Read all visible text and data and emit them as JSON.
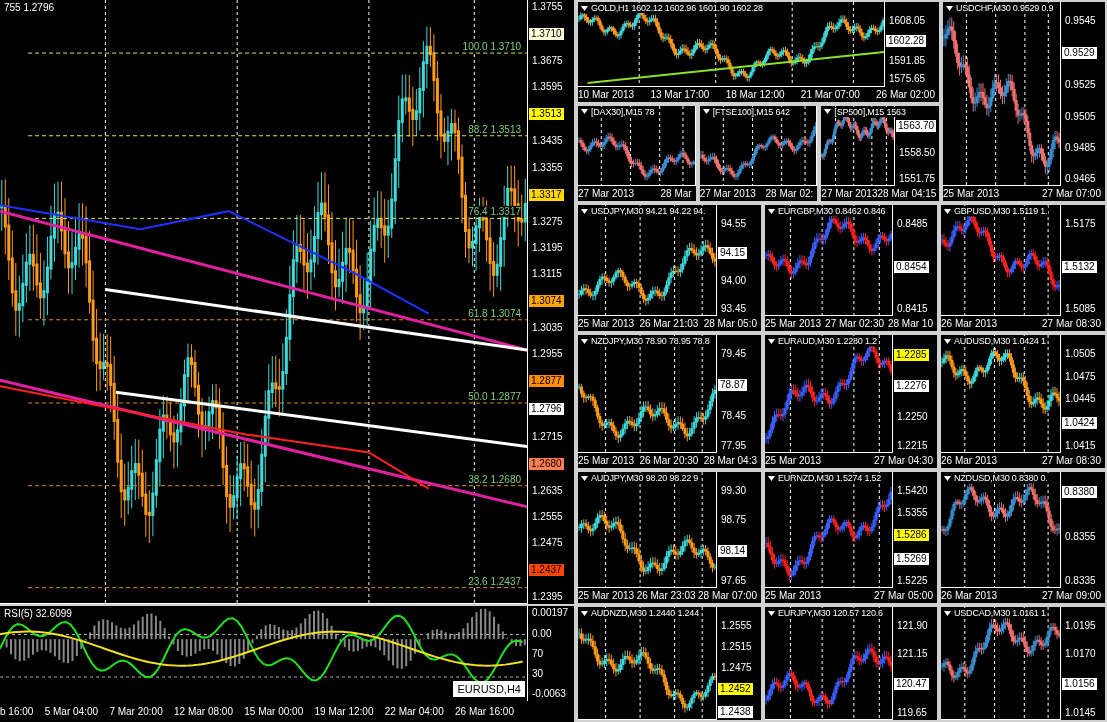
{
  "main_chart": {
    "title": "755 1.2796",
    "fib_levels": [
      {
        "label": "100.0 1.3710"
      },
      {
        "label": "88.2 1.3513"
      },
      {
        "label": "76.4 1.3317"
      },
      {
        "label": "61.8 1.3074"
      },
      {
        "label": "50.0 1.2877"
      },
      {
        "label": "38.2 1.2680"
      },
      {
        "label": "23.6 1.2437"
      }
    ],
    "price_axis": [
      {
        "kind": "tick",
        "text": "1.3755"
      },
      {
        "kind": "tag",
        "text": "1.3710",
        "color": "#fffbd8"
      },
      {
        "kind": "tick",
        "text": "1.3675"
      },
      {
        "kind": "tick",
        "text": "1.3595"
      },
      {
        "kind": "tag",
        "text": "1.3513",
        "color": "#ffff00"
      },
      {
        "kind": "tick",
        "text": "1.3435"
      },
      {
        "kind": "tick",
        "text": "1.3355"
      },
      {
        "kind": "tag",
        "text": "1.3317",
        "color": "#ffd700"
      },
      {
        "kind": "tick",
        "text": "1.3275"
      },
      {
        "kind": "tick",
        "text": "1.3195"
      },
      {
        "kind": "tick",
        "text": "1.3115"
      },
      {
        "kind": "tag",
        "text": "1.3074",
        "color": "#ffa500"
      },
      {
        "kind": "tick",
        "text": "1.3035"
      },
      {
        "kind": "tick",
        "text": "1.2955"
      },
      {
        "kind": "tag",
        "text": "1.2877",
        "color": "#ff8c00"
      },
      {
        "kind": "tag",
        "text": "1.2796",
        "color": "#ffffff"
      },
      {
        "kind": "tick",
        "text": "1.2715"
      },
      {
        "kind": "tag",
        "text": "1.2680",
        "color": "#ff7f50"
      },
      {
        "kind": "tick",
        "text": "1.2635"
      },
      {
        "kind": "tick",
        "text": "1.2555"
      },
      {
        "kind": "tick",
        "text": "1.2475"
      },
      {
        "kind": "tag",
        "text": "1.2437",
        "color": "#ff4500"
      },
      {
        "kind": "tick",
        "text": "1.2395"
      }
    ],
    "indicator": {
      "title": "RSI(5) 32.6099",
      "axis": [
        "0.00197",
        "0.00",
        "70",
        "30",
        "-0.0063"
      ],
      "symbol": "EURUSD,H4"
    },
    "time_axis": [
      "b 16:00",
      "5 Mar 04:00",
      "7 Mar 20:00",
      "12 Mar 08:00",
      "15 Mar 00:00",
      "19 Mar 12:00",
      "22 Mar 04:00",
      "26 Mar 16:00"
    ]
  },
  "mini_charts": [
    {
      "title": "GOLD,H1 1602.12 1602.96 1601.90 1602.28",
      "price_axis": [
        {
          "kind": "tick",
          "text": "1608.05"
        },
        {
          "kind": "tag",
          "text": "1602.28",
          "color": "#ffffff"
        },
        {
          "kind": "tick",
          "text": "1591.85"
        },
        {
          "kind": "tick",
          "text": "1575.65"
        }
      ],
      "time_axis": [
        "10 Mar 2013",
        "13 Mar 17:00",
        "18 Mar 12:00",
        "21 Mar 07:00",
        "26 Mar 02:00"
      ]
    },
    {
      "title": "[DAX30],M15 78",
      "time_axis": [
        "27 Mar 2013",
        "28 Mar"
      ]
    },
    {
      "title": "[FTSE100],M15 642",
      "time_axis": [
        "27 Mar 2013",
        "28 Mar 02:"
      ]
    },
    {
      "title": "[SP500],M15 1563",
      "price_axis": [
        {
          "kind": "tag",
          "text": "1563.70",
          "color": "#ffffff"
        },
        {
          "kind": "tick",
          "text": "1558.50"
        },
        {
          "kind": "tick",
          "text": "1551.75"
        }
      ],
      "time_axis": [
        "27 Mar 2013",
        "28 Mar 04:15"
      ]
    },
    {
      "title": "USDCHF,M30 0.9529 0.9",
      "price_axis": [
        {
          "kind": "tick",
          "text": "0.9545"
        },
        {
          "kind": "tag",
          "text": "0.9529",
          "color": "#ffffff"
        },
        {
          "kind": "tick",
          "text": "0.9525"
        },
        {
          "kind": "tick",
          "text": "0.9505"
        },
        {
          "kind": "tick",
          "text": "0.9485"
        },
        {
          "kind": "tick",
          "text": "0.9465"
        }
      ],
      "time_axis": [
        "25 Mar 2013",
        "27 Mar 07:00"
      ]
    },
    {
      "title": "USDJPY,M30 94.21 94.22 94.",
      "price_axis": [
        {
          "kind": "tick",
          "text": "94.55"
        },
        {
          "kind": "tag",
          "text": "94.15",
          "color": "#ffffff"
        },
        {
          "kind": "tick",
          "text": "94.00"
        },
        {
          "kind": "tick",
          "text": "93.45"
        }
      ],
      "time_axis": [
        "25 Mar 2013",
        "26 Mar 21:03",
        "28 Mar 05:0"
      ]
    },
    {
      "title": "EURGBP,M30 0.8462 0.846",
      "price_axis": [
        {
          "kind": "tick",
          "text": "0.8485"
        },
        {
          "kind": "tag",
          "text": "0.8454",
          "color": "#ffffff"
        },
        {
          "kind": "tick",
          "text": "0.8415"
        }
      ],
      "time_axis": [
        "25 Mar 2013",
        "27 Mar 02:30",
        "28 Mar 10"
      ]
    },
    {
      "title": "GBPUSD,M30 1.5119 1.",
      "price_axis": [
        {
          "kind": "tick",
          "text": "1.5175"
        },
        {
          "kind": "tag",
          "text": "1.5132",
          "color": "#ffffff"
        },
        {
          "kind": "tick",
          "text": "1.5085"
        }
      ],
      "time_axis": [
        "26 Mar 2013",
        "27 Mar 08:30"
      ]
    },
    {
      "title": "NZDJPY,M30 78.90 78.95 78.8",
      "price_axis": [
        {
          "kind": "tick",
          "text": "79.45"
        },
        {
          "kind": "tag",
          "text": "78.87",
          "color": "#ffffff"
        },
        {
          "kind": "tick",
          "text": "78.45"
        },
        {
          "kind": "tick",
          "text": "77.95"
        }
      ],
      "time_axis": [
        "25 Mar 2013",
        "26 Mar 20:30",
        "28 Mar 04:3"
      ]
    },
    {
      "title": "EURAUD,M30 1.2280 1.2",
      "price_axis": [
        {
          "kind": "tag",
          "text": "1.2285",
          "color": "#ffff00"
        },
        {
          "kind": "tag",
          "text": "1.2276",
          "color": "#ffffff"
        },
        {
          "kind": "tick",
          "text": "1.2250"
        },
        {
          "kind": "tick",
          "text": "1.2215"
        }
      ],
      "time_axis": [
        "25 Mar 2013",
        "27 Mar 04:30"
      ]
    },
    {
      "title": "AUDUSD,M30 1.0424 1",
      "price_axis": [
        {
          "kind": "tick",
          "text": "1.0505"
        },
        {
          "kind": "tick",
          "text": "1.0475"
        },
        {
          "kind": "tick",
          "text": "1.0445"
        },
        {
          "kind": "tag",
          "text": "1.0424",
          "color": "#ffffff"
        },
        {
          "kind": "tick",
          "text": "1.0415"
        }
      ],
      "time_axis": [
        "26 Mar 2013",
        "27 Mar 08:30"
      ]
    },
    {
      "title": "AUDJPY,M30 98.20 98.22 9",
      "price_axis": [
        {
          "kind": "tick",
          "text": "99.30"
        },
        {
          "kind": "tick",
          "text": "98.75"
        },
        {
          "kind": "tag",
          "text": "98.14",
          "color": "#ffffff"
        },
        {
          "kind": "tick",
          "text": "97.65"
        }
      ],
      "time_axis": [
        "25 Mar 2013",
        "26 Mar 23:03",
        "28 Mar 07:00"
      ]
    },
    {
      "title": "EURNZD,M30 1.5274 1.52",
      "price_axis": [
        {
          "kind": "tick",
          "text": "1.5420"
        },
        {
          "kind": "tick",
          "text": "1.5355"
        },
        {
          "kind": "tag",
          "text": "1.5286",
          "color": "#ffff00"
        },
        {
          "kind": "tag",
          "text": "1.5269",
          "color": "#ffffff"
        },
        {
          "kind": "tick",
          "text": "1.5225"
        }
      ],
      "time_axis": [
        "25 Mar 2013",
        "27 Mar 05:00"
      ]
    },
    {
      "title": "NZDUSD,M30 0.8380 0.",
      "price_axis": [
        {
          "kind": "tag",
          "text": "0.8380",
          "color": "#ffffff"
        },
        {
          "kind": "tick",
          "text": "0.8355"
        },
        {
          "kind": "tick",
          "text": "0.8335"
        }
      ],
      "time_axis": [
        "26 Mar 2013",
        "27 Mar 09:00"
      ]
    },
    {
      "title": "AUDNZD,M30 1.2440 1.244",
      "price_axis": [
        {
          "kind": "tick",
          "text": "1.2555"
        },
        {
          "kind": "tick",
          "text": "1.2515"
        },
        {
          "kind": "tick",
          "text": "1.2475"
        },
        {
          "kind": "tag",
          "text": "1.2452",
          "color": "#ffff00"
        },
        {
          "kind": "tag",
          "text": "1.2438",
          "color": "#ffffff"
        }
      ]
    },
    {
      "title": "EURJPY,M30 120.57 120.6",
      "price_axis": [
        {
          "kind": "tick",
          "text": "121.90"
        },
        {
          "kind": "tick",
          "text": "121.15"
        },
        {
          "kind": "tag",
          "text": "120.47",
          "color": "#ffffff"
        },
        {
          "kind": "tick",
          "text": "119.65"
        }
      ]
    },
    {
      "title": "USDCAD,M30 1.0161 1",
      "price_axis": [
        {
          "kind": "tick",
          "text": "1.0195"
        },
        {
          "kind": "tick",
          "text": "1.0170"
        },
        {
          "kind": "tag",
          "text": "1.0156",
          "color": "#ffffff"
        },
        {
          "kind": "tick",
          "text": "1.0145"
        }
      ]
    }
  ]
}
